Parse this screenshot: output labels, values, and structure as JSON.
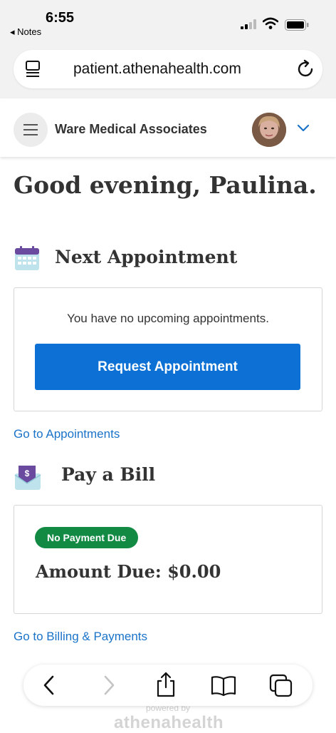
{
  "status_bar": {
    "time": "6:55",
    "back_app": "◂ Notes"
  },
  "browser": {
    "url": "patient.athenahealth.com"
  },
  "header": {
    "practice_name": "Ware Medical Associates"
  },
  "greeting": "Good evening, Paulina.",
  "appointment_section": {
    "title": "Next Appointment",
    "empty_message": "You have no upcoming appointments.",
    "request_button": "Request Appointment",
    "link": "Go to Appointments"
  },
  "bill_section": {
    "title": "Pay a Bill",
    "status_badge": "No Payment Due",
    "amount_due": "Amount Due: $0.00",
    "link": "Go to Billing & Payments"
  },
  "footer": {
    "powered_by": "powered by",
    "brand": "athenahealth"
  },
  "colors": {
    "primary": "#0c70d4",
    "link": "#1a73c8",
    "badge_green": "#138a44"
  },
  "icons": [
    "signal-icon",
    "wifi-icon",
    "battery-icon",
    "tabs-icon",
    "reload-icon",
    "menu-icon",
    "chevron-down-icon",
    "calendar-icon",
    "bill-envelope-icon",
    "back-arrow-icon",
    "forward-arrow-icon",
    "share-icon",
    "bookmarks-icon",
    "tabs-overview-icon"
  ]
}
